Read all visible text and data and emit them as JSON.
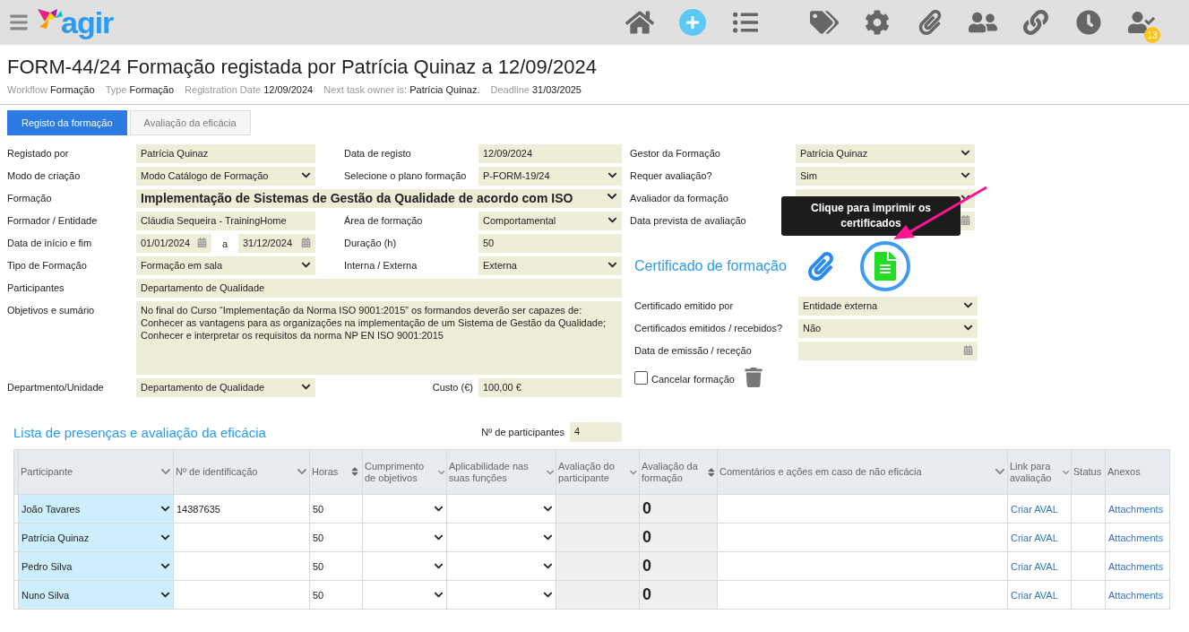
{
  "topbar": {
    "logo": "agir",
    "badge": "13"
  },
  "header": {
    "title": "FORM-44/24 Formação registada por Patrícia Quinaz a 12/09/2024",
    "meta": [
      {
        "label": "Workflow",
        "value": "Formação"
      },
      {
        "label": "Type",
        "value": "Formação"
      },
      {
        "label": "Registration Date",
        "value": "12/09/2024"
      },
      {
        "label": "Next task owner is:",
        "value": "Patrícia Quinaz."
      },
      {
        "label": "Deadline",
        "value": "31/03/2025"
      }
    ]
  },
  "tabs": [
    {
      "label": "Registo da formação",
      "selected": true
    },
    {
      "label": "Avaliação da eficácia",
      "selected": false
    }
  ],
  "form": {
    "rows": [
      {
        "fields": [
          {
            "label": "Registado por",
            "kind": "text",
            "value": "Patrícia Quinaz"
          },
          {
            "label": "Data de registo",
            "kind": "text",
            "value": "12/09/2024"
          }
        ]
      },
      {
        "fields": [
          {
            "label": "Modo de criação",
            "kind": "select",
            "value": "Modo Catálogo de Formação"
          },
          {
            "label": "Selecione o plano formação",
            "kind": "select",
            "value": "P-FORM-19/24"
          }
        ]
      },
      {
        "fields": [
          {
            "label": "Formação",
            "kind": "bigselect",
            "value": "Implementação de Sistemas de Gestão da Qualidade de acordo com ISO"
          }
        ]
      },
      {
        "fields": [
          {
            "label": "Formador / Entidade",
            "kind": "text",
            "value": "Cláudia Sequeira - TrainingHome"
          },
          {
            "label": "Área de formação",
            "kind": "select",
            "value": "Comportamental"
          }
        ]
      },
      {
        "fields": [
          {
            "label": "Data de início e fim",
            "kind": "daterange",
            "value": "01/01/2024",
            "separator": "a",
            "end": "31/12/2024"
          },
          {
            "label": "Duração (h)",
            "kind": "text",
            "value": "50"
          }
        ]
      },
      {
        "fields": [
          {
            "label": "Tipo de Formação",
            "kind": "select",
            "value": "Formação em sala"
          },
          {
            "label": "Interna / Externa",
            "kind": "select",
            "value": "Externa"
          }
        ]
      },
      {
        "fields": [
          {
            "label": "Participantes",
            "kind": "text",
            "value": "Departamento de Qualidade"
          }
        ]
      },
      {
        "fields": [
          {
            "label": "Objetivos e sumário",
            "kind": "textarea",
            "value": "No final do Curso “Implementação da Norma ISO 9001:2015” os formandos deverão ser capazes de:\nConhecer as vantagens para as organizações na implementação de um Sistema de Gestão da Qualidade;\nConhecer e interpretar os requisitos da norma NP EN ISO 9001:2015"
          }
        ]
      },
      {
        "fields": [
          {
            "label": "Departmento/Unidade",
            "kind": "select",
            "value": "Departamento de Qualidade"
          },
          {
            "label": "Custo (€)",
            "kind": "text",
            "value": "100,00 €"
          }
        ]
      }
    ],
    "right": [
      {
        "label": "Gestor da Formação",
        "kind": "select",
        "value": "Patrícia Quinaz"
      },
      {
        "label": "Requer avaliação?",
        "kind": "select",
        "value": "Sim"
      },
      {
        "label": "Avaliador da formação",
        "kind": "select"
      },
      {
        "label": "Data prevista de avaliação",
        "kind": "date"
      }
    ],
    "certificate": {
      "title": "Certificado de formação",
      "tooltip": "Clique para imprimir os certificados",
      "fields": [
        {
          "label": "Certificado emitido por",
          "kind": "select",
          "value": "Entidade externa"
        },
        {
          "label": "Certificados emitidos / recebidos?",
          "kind": "select",
          "value": "Não"
        },
        {
          "label": "Data de emissão / receção",
          "kind": "date"
        }
      ],
      "cancel": {
        "label": "Cancelar formação",
        "checked": false
      }
    }
  },
  "attendance": {
    "title": "Lista de presenças e avaliação da eficácia",
    "count_label": "Nº de participantes",
    "count": "4",
    "columns": [
      {
        "label": "Participante",
        "kind": "filter"
      },
      {
        "label": "Nº de identificação",
        "kind": "filter"
      },
      {
        "label": "Horas",
        "kind": "sortable"
      },
      {
        "label": "Cumprimento de objetivos",
        "kind": "filter"
      },
      {
        "label": "Aplicabilidade nas suas funções",
        "kind": "filter"
      },
      {
        "label": "Avaliação do participante",
        "kind": "filter"
      },
      {
        "label": "Avaliação da formação",
        "kind": "sortable"
      },
      {
        "label": "Comentários e ações em caso de não eficácia",
        "kind": "filter"
      },
      {
        "label": "Link para avaliação",
        "kind": "filter"
      },
      {
        "label": "Status",
        "kind": "plain"
      },
      {
        "label": "Anexos",
        "kind": "plain"
      }
    ],
    "rows": [
      {
        "participant": "João Tavares",
        "id": "14387635",
        "hours": "50",
        "score": "0",
        "link": "Criar AVAL",
        "attachments": "Attachments"
      },
      {
        "participant": "Patrícia Quinaz",
        "hours": "50",
        "score": "0",
        "link": "Criar AVAL",
        "attachments": "Attachments"
      },
      {
        "participant": "Pedro Silva",
        "hours": "50",
        "score": "0",
        "link": "Criar AVAL",
        "attachments": "Attachments"
      },
      {
        "participant": "Nuno Silva",
        "hours": "50",
        "score": "0",
        "link": "Criar AVAL",
        "attachments": "Attachments"
      }
    ]
  }
}
